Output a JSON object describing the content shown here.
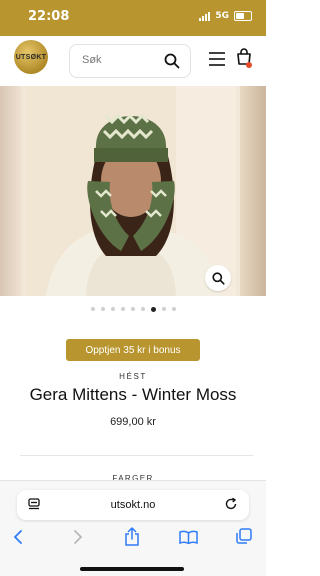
{
  "status": {
    "time": "22:08",
    "network": "5G"
  },
  "header": {
    "logo_text": "UTSØKT",
    "search_placeholder": "Søk"
  },
  "gallery": {
    "dot_count": 9,
    "active_index": 6
  },
  "product": {
    "bonus_label": "Opptjen 35 kr i bonus",
    "brand": "HÉST",
    "title": "Gera Mittens - Winter Moss",
    "price": "699,00 kr",
    "colors_heading": "FARGER"
  },
  "browser": {
    "url": "utsokt.no"
  },
  "colors": {
    "accent": "#b8952e",
    "mitten_green": "#5d7146",
    "cart_dot": "#e54b2b"
  }
}
